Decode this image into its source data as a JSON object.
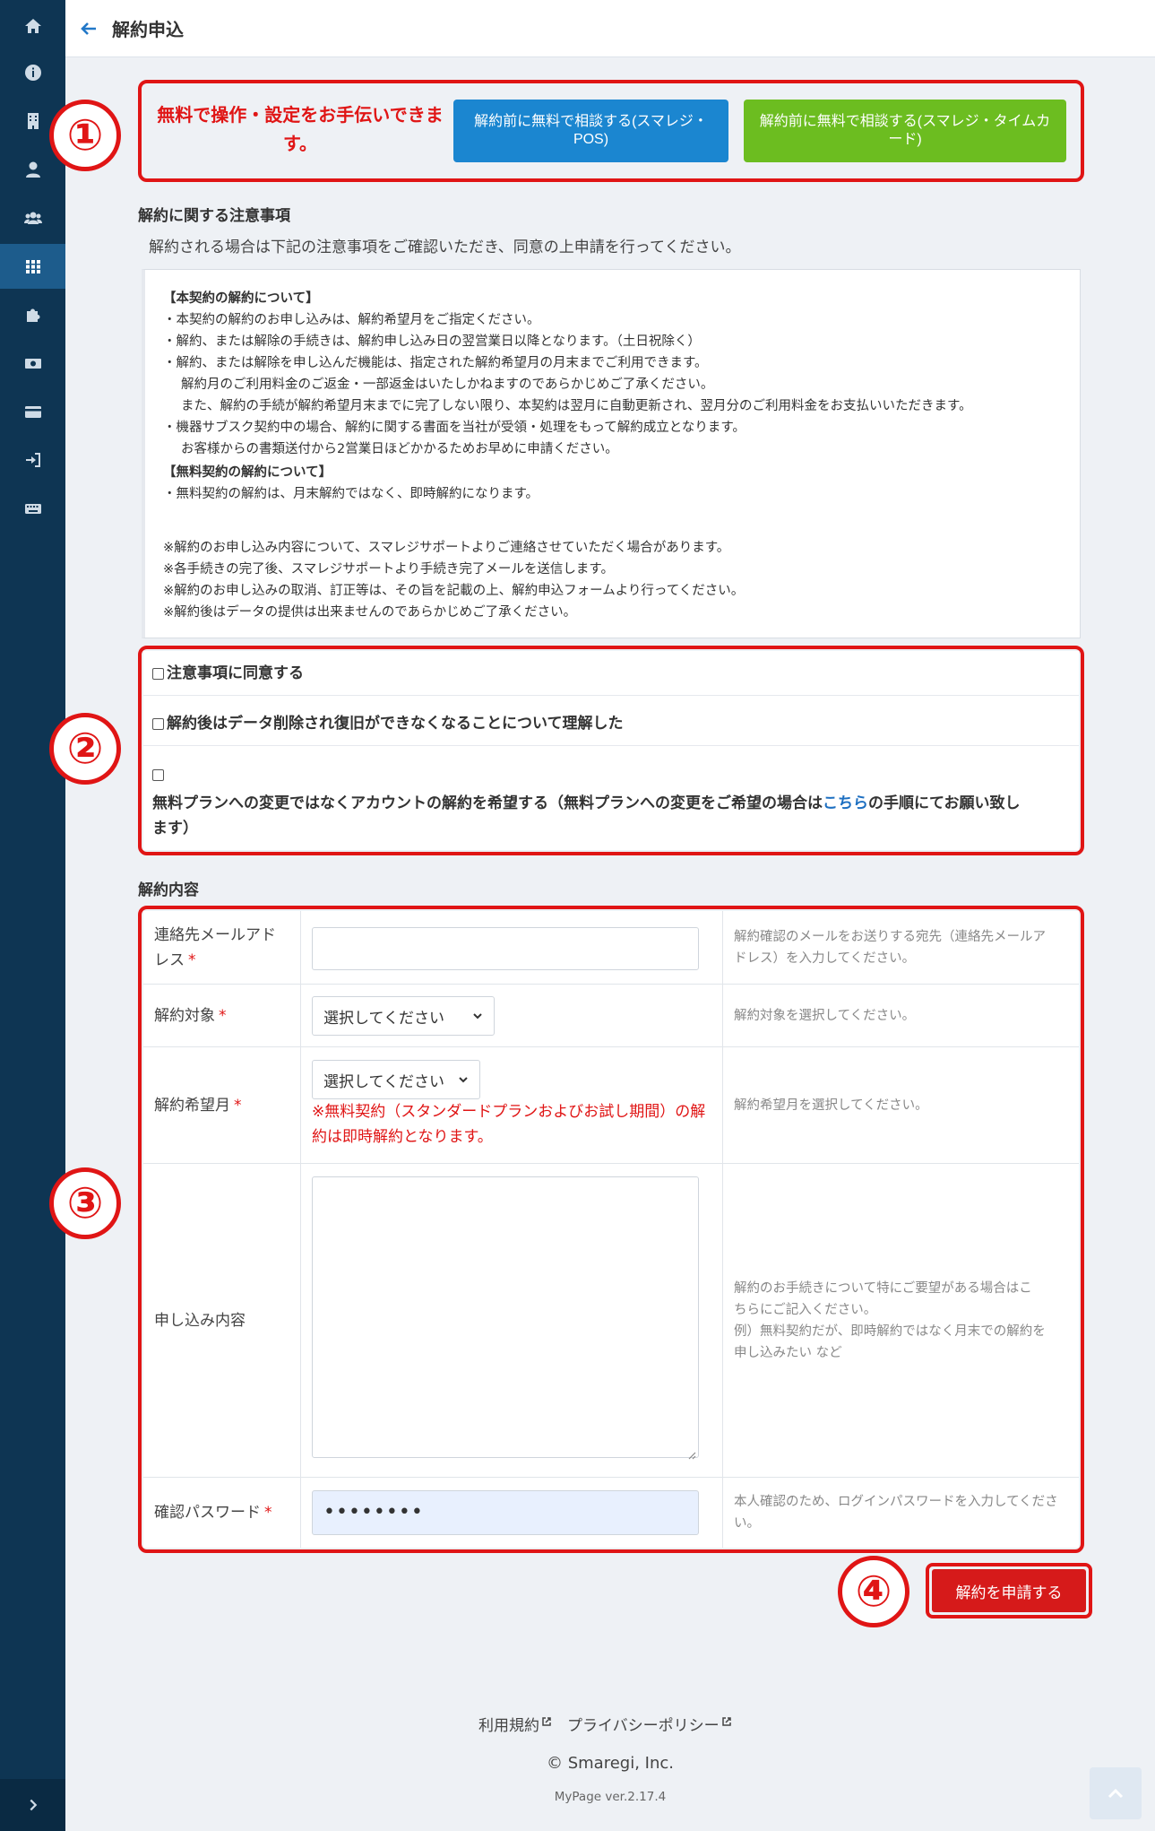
{
  "header": {
    "title": "解約申込"
  },
  "sidebar": {
    "items": [
      {
        "icon": "home-icon"
      },
      {
        "icon": "info-icon"
      },
      {
        "icon": "building-icon"
      },
      {
        "icon": "user-icon"
      },
      {
        "icon": "users-icon"
      },
      {
        "icon": "apps-grid-icon",
        "active": true
      },
      {
        "icon": "puzzle-icon"
      },
      {
        "icon": "money-icon"
      },
      {
        "icon": "credit-card-icon"
      },
      {
        "icon": "sign-in-icon"
      },
      {
        "icon": "keyboard-icon"
      }
    ],
    "expand_icon": "chevron-right-icon"
  },
  "markers": [
    "①",
    "②",
    "③",
    "④"
  ],
  "help": {
    "text": "無料で操作・設定をお手伝いできます。",
    "consult_pos_label": "解約前に無料で相談する(スマレジ・POS)",
    "consult_timecard_label": "解約前に無料で相談する(スマレジ・タイムカード)"
  },
  "notice": {
    "title": "解約に関する注意事項",
    "subtitle": "解約される場合は下記の注意事項をご確認いただき、同意の上申請を行ってください。",
    "heading_main": "【本契約の解約について】",
    "main_lines": [
      "・本契約の解約のお申し込みは、解約希望月をご指定ください。",
      "・解約、または解除の手続きは、解約申し込み日の翌営業日以降となります。（土日祝除く）",
      "・解約、または解除を申し込んだ機能は、指定された解約希望月の月末までご利用できます。",
      "解約月のご利用料金のご返金・一部返金はいたしかねますのであらかじめご了承ください。",
      "また、解約の手続が解約希望月末までに完了しない限り、本契約は翌月に自動更新され、翌月分のご利用料金をお支払いいただきます。",
      "・機器サブスク契約中の場合、解約に関する書面を当社が受領・処理をもって解約成立となります。",
      "お客様からの書類送付から2営業日ほどかかるためお早めに申請ください。"
    ],
    "heading_free": "【無料契約の解約について】",
    "free_lines": [
      "・無料契約の解約は、月末解約ではなく、即時解約になります。"
    ],
    "footnotes": [
      "※解約のお申し込み内容について、スマレジサポートよりご連絡させていただく場合があります。",
      "※各手続きの完了後、スマレジサポートより手続き完了メールを送信します。",
      "※解約のお申し込みの取消、訂正等は、その旨を記載の上、解約申込フォームより行ってください。",
      "※解約後はデータの提供は出来ませんのであらかじめご了承ください。"
    ]
  },
  "agree": {
    "agree_notes": "注意事項に同意する",
    "understand_delete": "解約後はデータ削除され復旧ができなくなることについて理解した",
    "cancel_text_1": "無料プランへの変更ではなくアカウントの解約を希望する（無料プランへの変更をご希望の場合は",
    "cancel_link": "こちら",
    "cancel_text_2": "の手順にてお願い致し",
    "cancel_text_3": "ます）"
  },
  "form": {
    "title": "解約内容",
    "required_mark": "*",
    "email": {
      "label_1": "連絡先メールアド",
      "label_2": "レス",
      "value": "",
      "note_1": "解約確認のメールをお送りする宛先（連絡先メールア",
      "note_2": "ドレス）を入力してください。"
    },
    "target": {
      "label": "解約対象",
      "selected": "選択してください",
      "note": "解約対象を選択してください。"
    },
    "month": {
      "label": "解約希望月",
      "selected": "選択してください",
      "warning_1": "※無料契約（スタンダードプランおよびお試し期間）の解",
      "warning_2": "約は即時解約となります。",
      "note": "解約希望月を選択してください。"
    },
    "details": {
      "label": "申し込み内容",
      "value": "",
      "note_1": "解約のお手続きについて特にご要望がある場合はこ",
      "note_2": "ちらにご記入ください。",
      "note_3": "例）無料契約だが、即時解約ではなく月末での解約を",
      "note_4": "申し込みたい など"
    },
    "password": {
      "label": "確認パスワード",
      "value": "••••••••",
      "note_1": "本人確認のため、ログインパスワードを入力してくださ",
      "note_2": "い。"
    }
  },
  "submit_label": "解約を申請する",
  "footer": {
    "terms": "利用規約",
    "privacy": "プライバシーポリシー",
    "copyright": "© Smaregi, Inc.",
    "version": "MyPage ver.2.17.4"
  },
  "colors": {
    "sidebar_bg": "#0e3553",
    "accent_blue": "#1b86d0",
    "accent_green": "#6cbd20",
    "alert_red": "#e01515"
  }
}
